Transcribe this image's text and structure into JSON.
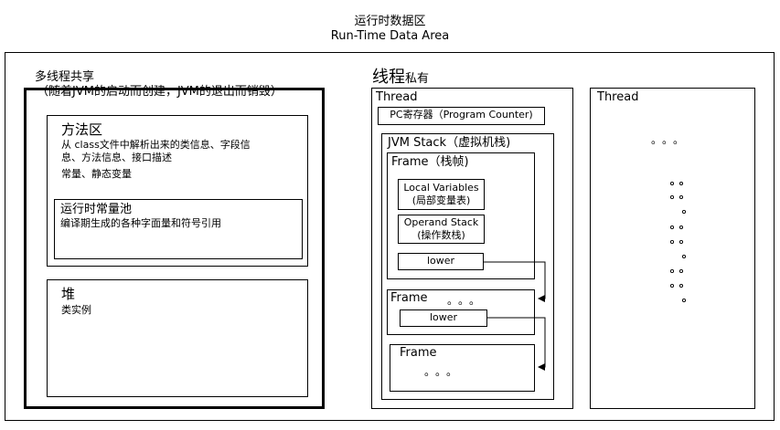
{
  "title_cn": "运行时数据区",
  "title_en": "Run-Time Data Area",
  "shared": {
    "title": "多线程共享",
    "subtitle": "（随着JVM的启动而创建，JVM的退出而销毁）",
    "method_area": {
      "title": "方法区",
      "desc_line1": "从 class文件中解析出来的类信息、字段信",
      "desc_line2": "息、方法信息、接口描述",
      "desc_line3": "常量、静态变量",
      "constant_pool": {
        "title": "运行时常量池",
        "desc": "编译期生成的各种字面量和符号引用"
      }
    },
    "heap": {
      "title": "堆",
      "desc": "类实例"
    }
  },
  "private": {
    "title_big": "线程",
    "title_small": "私有",
    "thread1": {
      "label": "Thread",
      "pc": "PC寄存器（Program Counter)",
      "jvm_stack": "JVM Stack（虚拟机栈)",
      "frame1": {
        "title": "Frame（栈帧)",
        "local_vars_line1": "Local Variables",
        "local_vars_line2": "(局部变量表)",
        "operand_line1": "Operand Stack",
        "operand_line2": "(操作数栈)",
        "lower": "lower"
      },
      "frame2": {
        "title": "Frame",
        "dots": "。。。",
        "lower": "lower"
      },
      "frame3": {
        "title": "Frame",
        "dots": "。。。"
      }
    },
    "thread2": {
      "label": "Thread",
      "dots_top": "。。。"
    }
  }
}
